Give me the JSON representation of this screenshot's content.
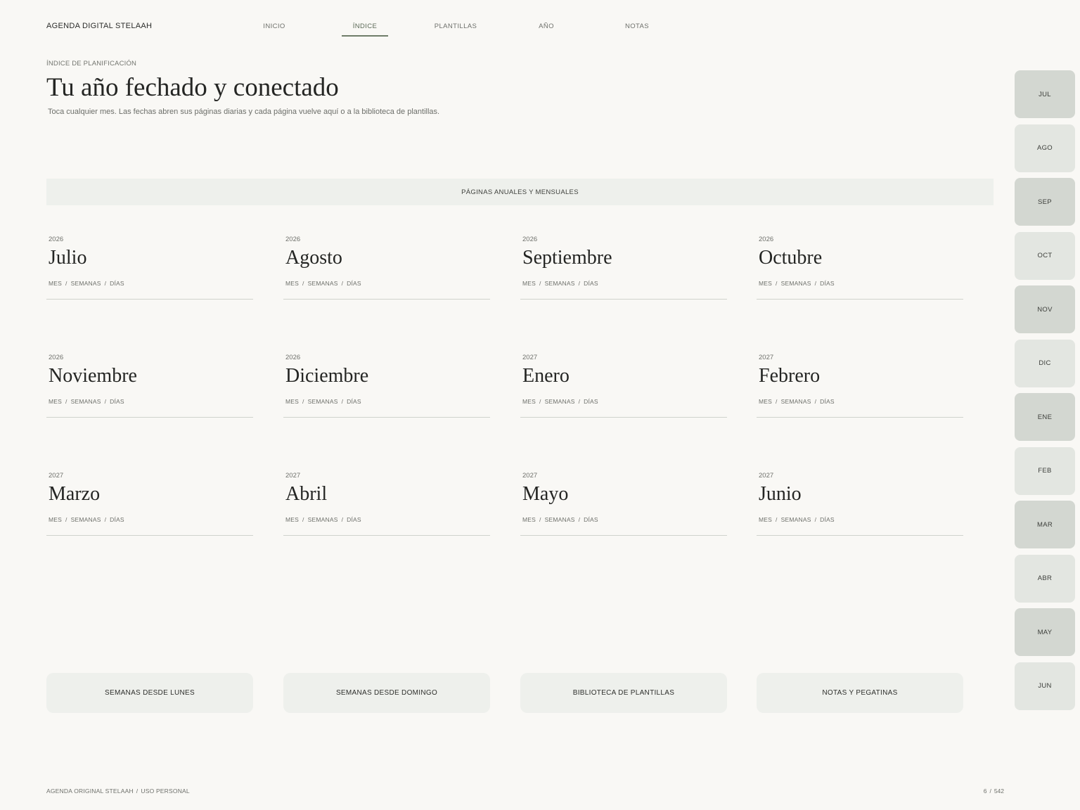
{
  "header": {
    "brand": "AGENDA DIGITAL STELAAH",
    "nav": [
      {
        "label": "INICIO"
      },
      {
        "label": "ÍNDICE",
        "active": true
      },
      {
        "label": "PLANTILLAS"
      },
      {
        "label": "AÑO"
      },
      {
        "label": "NOTAS"
      }
    ]
  },
  "intro": {
    "eyebrow": "ÍNDICE DE PLANIFICACIÓN",
    "title": "Tu año fechado y conectado",
    "subtitle": "Toca cualquier mes. Las fechas abren sus páginas diarias y cada página vuelve aquí o a la biblioteca de plantillas."
  },
  "section": {
    "label": "PÁGINAS ANUALES Y MENSUALES"
  },
  "month_links": {
    "mes": "MES",
    "semanas": "SEMANAS",
    "dias": "DÍAS",
    "separator": "/"
  },
  "months": [
    {
      "year": "2026",
      "name": "Julio"
    },
    {
      "year": "2026",
      "name": "Agosto"
    },
    {
      "year": "2026",
      "name": "Septiembre"
    },
    {
      "year": "2026",
      "name": "Octubre"
    },
    {
      "year": "2026",
      "name": "Noviembre"
    },
    {
      "year": "2026",
      "name": "Diciembre"
    },
    {
      "year": "2027",
      "name": "Enero"
    },
    {
      "year": "2027",
      "name": "Febrero"
    },
    {
      "year": "2027",
      "name": "Marzo"
    },
    {
      "year": "2027",
      "name": "Abril"
    },
    {
      "year": "2027",
      "name": "Mayo"
    },
    {
      "year": "2027",
      "name": "Junio"
    }
  ],
  "bottom_buttons": [
    {
      "label": "SEMANAS DESDE LUNES"
    },
    {
      "label": "SEMANAS DESDE DOMINGO"
    },
    {
      "label": "BIBLIOTECA DE PLANTILLAS"
    },
    {
      "label": "NOTAS Y PEGATINAS"
    }
  ],
  "side_tabs": [
    {
      "label": "JUL"
    },
    {
      "label": "AGO"
    },
    {
      "label": "SEP"
    },
    {
      "label": "OCT"
    },
    {
      "label": "NOV"
    },
    {
      "label": "DIC"
    },
    {
      "label": "ENE"
    },
    {
      "label": "FEB"
    },
    {
      "label": "MAR"
    },
    {
      "label": "ABR"
    },
    {
      "label": "MAY"
    },
    {
      "label": "JUN"
    }
  ],
  "footer": {
    "left_a": "AGENDA ORIGINAL STELAAH",
    "left_b": "USO PERSONAL",
    "separator": "/",
    "page_current": "6",
    "page_total": "542"
  },
  "colors": {
    "background": "#f9f8f5",
    "accent": "#6f7d69",
    "band": "#eef0ec",
    "tab_dark": "#d3d7d1",
    "tab_light": "#e3e6e1"
  }
}
